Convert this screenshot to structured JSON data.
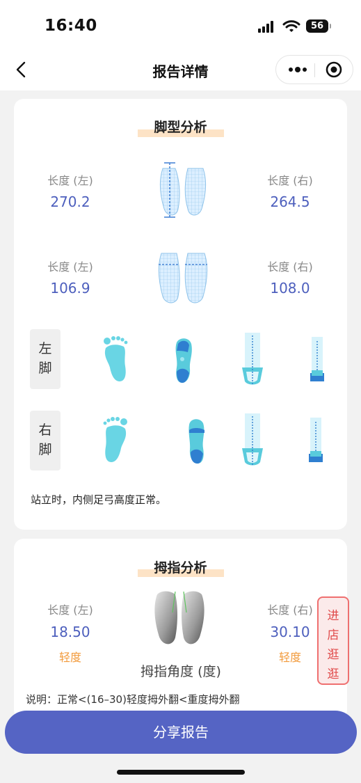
{
  "status_bar": {
    "time": "16:40",
    "battery": "56"
  },
  "nav": {
    "title": "报告详情"
  },
  "foot_analysis": {
    "title": "脚型分析",
    "length_row": {
      "left_label": "长度 (左)",
      "left_value": "270.2",
      "right_label": "长度 (右)",
      "right_value": "264.5"
    },
    "width_row": {
      "left_label": "长度 (左)",
      "left_value": "106.9",
      "right_label": "长度 (右)",
      "right_value": "108.0"
    },
    "left_foot_label": [
      "左",
      "脚"
    ],
    "right_foot_label": [
      "右",
      "脚"
    ],
    "description": "站立时，内侧足弓高度正常。"
  },
  "toe_analysis": {
    "title": "拇指分析",
    "left_label": "长度 (左)",
    "left_value": "18.50",
    "left_severity": "轻度",
    "right_label": "长度 (右)",
    "right_value": "30.10",
    "right_severity": "轻度",
    "angle_title": "拇指角度 (度)",
    "note": "说明：正常<(16–30)轻度拇外翻<重度拇外翻"
  },
  "store_button": [
    "进",
    "店",
    "逛",
    "逛"
  ],
  "share_button": "分享报告",
  "colors": {
    "accent": "#5564c4",
    "value_blue": "#4d5fbd",
    "severity_orange": "#f29a3b",
    "store_red": "#e04a4a",
    "foot_cyan": "#5fd3e0"
  }
}
